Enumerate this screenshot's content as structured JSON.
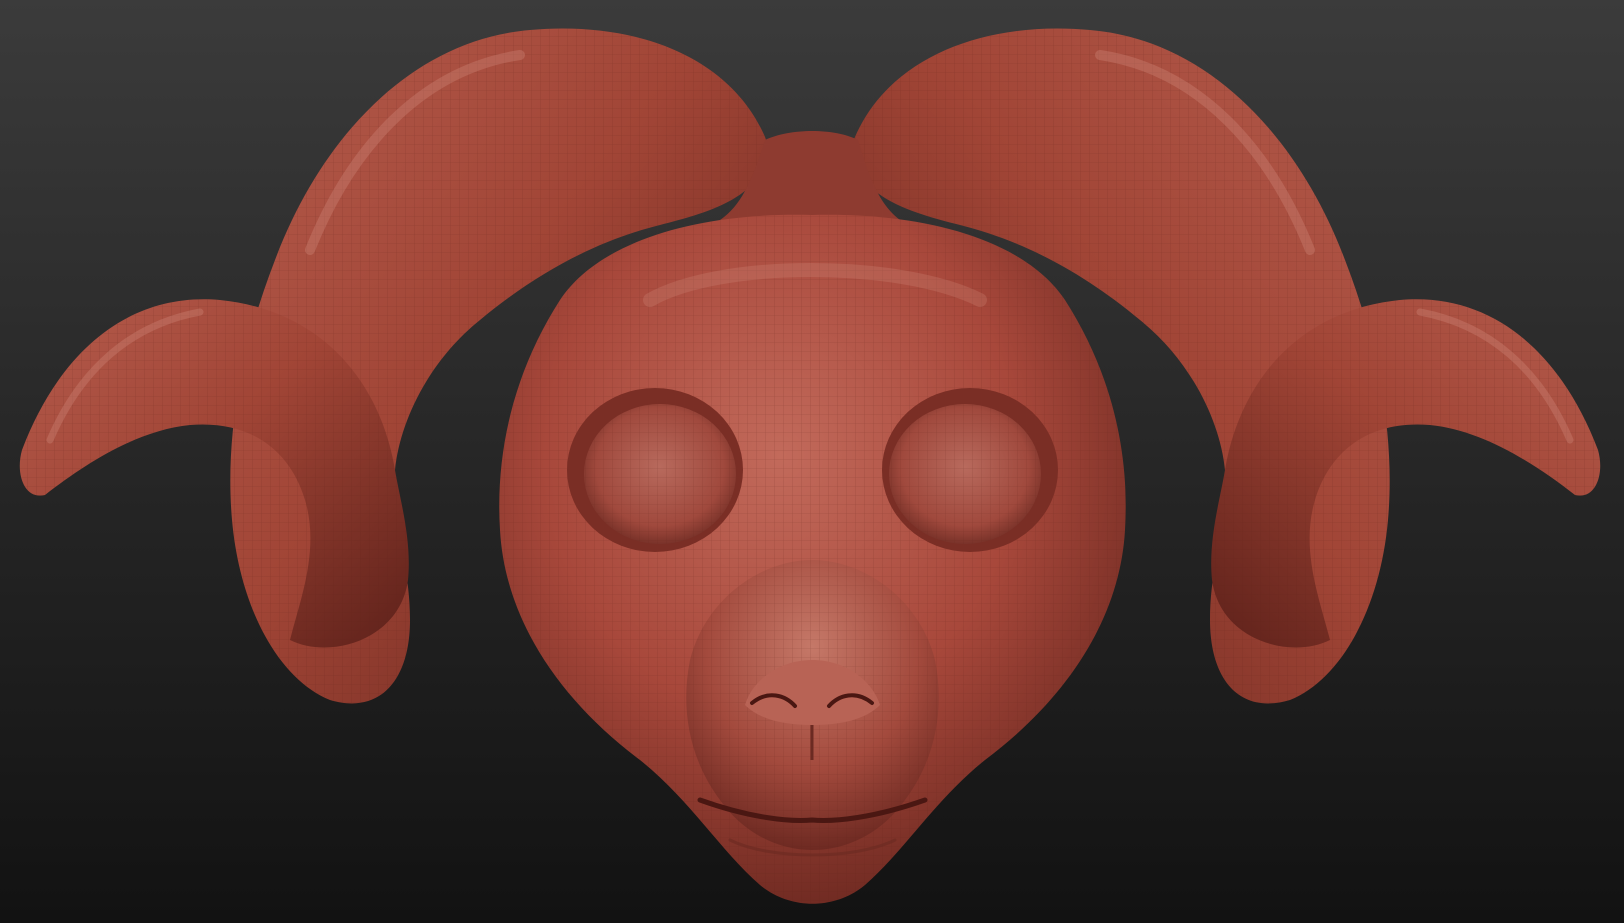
{
  "app": {
    "title": ""
  },
  "viewport": {
    "background_top": "#3b3b3b",
    "background_bottom": "#121212"
  },
  "model": {
    "name": "",
    "material_color": "#a8483b",
    "material_highlight": "#c97a6b",
    "material_shadow": "#5e211a",
    "wireframe_color": "#7a2e25",
    "parts": [
      "head",
      "left-horn",
      "right-horn",
      "left-eye-socket",
      "right-eye-socket",
      "nose",
      "mouth"
    ]
  }
}
